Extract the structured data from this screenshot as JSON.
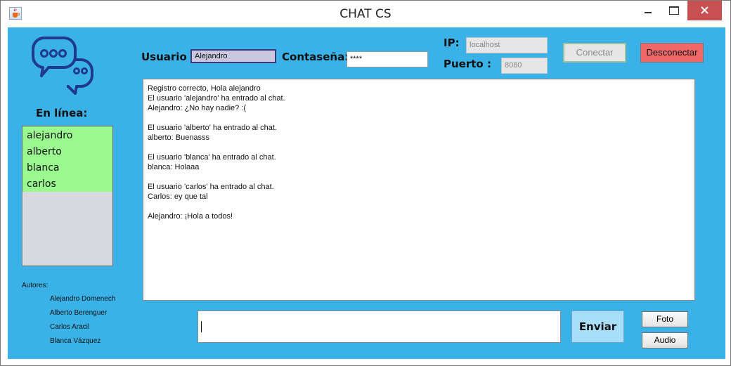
{
  "window": {
    "title": "CHAT CS"
  },
  "header": {
    "user_label": "Usuario :",
    "user_value": "Alejandro",
    "password_label": "Contaseña:",
    "password_value": "****",
    "ip_label": "IP:",
    "ip_value": "localhost",
    "port_label": "Puerto :",
    "port_value": "8080",
    "connect_label": "Conectar",
    "disconnect_label": "Desconectar"
  },
  "sidebar": {
    "online_title": "En línea:",
    "online_users": [
      "alejandro",
      "alberto",
      "blanca",
      "carlos"
    ],
    "authors_title": "Autores:",
    "authors": [
      "Alejandro Domenech",
      "Alberto Berenguer",
      "Carlos Aracil",
      "Blanca Vázquez"
    ]
  },
  "chat": {
    "lines": [
      "Registro correcto, Hola alejandro",
      "El usuario 'alejandro' ha entrado al chat.",
      "Alejandro: ¿No hay nadie? :(",
      "",
      "El usuario 'alberto' ha entrado al chat.",
      "alberto: Buenasss",
      "",
      "El usuario 'blanca' ha entrado al chat.",
      "blanca: Holaaa",
      "",
      "El usuario 'carlos' ha entrado al chat.",
      "Carlos: ey que tal",
      "",
      "Alejandro: ¡Hola a todos!"
    ]
  },
  "composer": {
    "message_value": "",
    "send_label": "Enviar",
    "photo_label": "Foto",
    "audio_label": "Audio"
  },
  "colors": {
    "background": "#3ab2e8",
    "online_highlight": "#9afa8f",
    "disconnect": "#f06868",
    "close_button": "#c75050",
    "logo": "#1f3a8a"
  },
  "icons": {
    "app": "java-cup-icon",
    "logo": "chat-bubbles-icon",
    "minimize": "minimize-icon",
    "maximize": "maximize-icon",
    "close": "close-icon"
  }
}
